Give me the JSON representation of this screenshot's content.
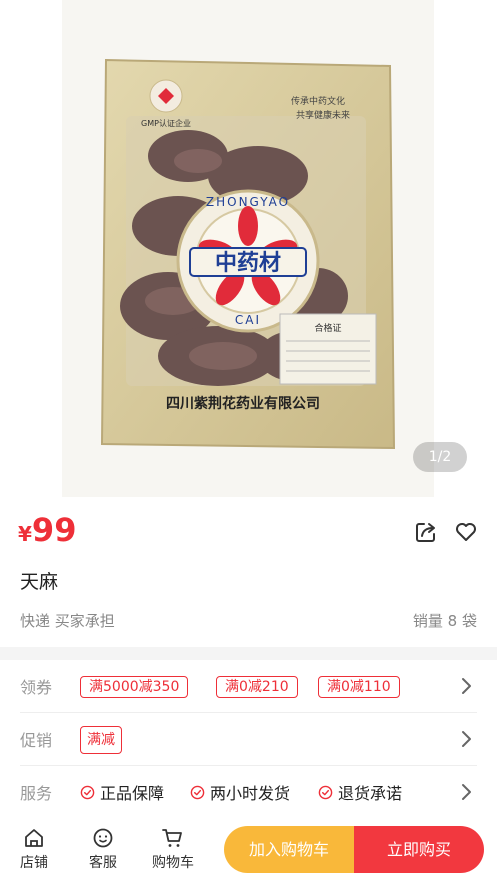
{
  "gallery": {
    "counter": "1/2",
    "packet_labels": {
      "company": "四川紫荆花药业有限公司",
      "brand": "中药材",
      "brand_ring_top": "ZHONGYAO",
      "brand_ring_bottom": "CAI",
      "gmp": "GMP认证企业",
      "slogan_1": "传承中药文化",
      "slogan_2": "共享健康未来",
      "spec_title": "合格证"
    }
  },
  "product": {
    "currency_symbol": "¥",
    "price": "99",
    "title": "天麻",
    "shipping": "快递 买家承担",
    "sales": "销量 8 袋"
  },
  "rows": {
    "coupon": {
      "label": "领券",
      "items": [
        "满5000减350",
        "满0减210",
        "满0减110"
      ]
    },
    "promotion": {
      "label": "促销",
      "tag": "满减"
    },
    "service": {
      "label": "服务",
      "items": [
        "正品保障",
        "两小时发货",
        "退货承诺"
      ]
    }
  },
  "bottom_bar": {
    "store": "店铺",
    "service": "客服",
    "cart": "购物车",
    "add_to_cart": "加入购物车",
    "buy_now": "立即购买"
  },
  "colors": {
    "accent_red": "#ee2f38",
    "cart_button": "#f9b83a",
    "buy_button": "#f2383f"
  },
  "icons": [
    "share-icon",
    "heart-icon",
    "chevron-right-icon",
    "check-circle-icon",
    "store-icon",
    "service-icon",
    "cart-icon"
  ]
}
